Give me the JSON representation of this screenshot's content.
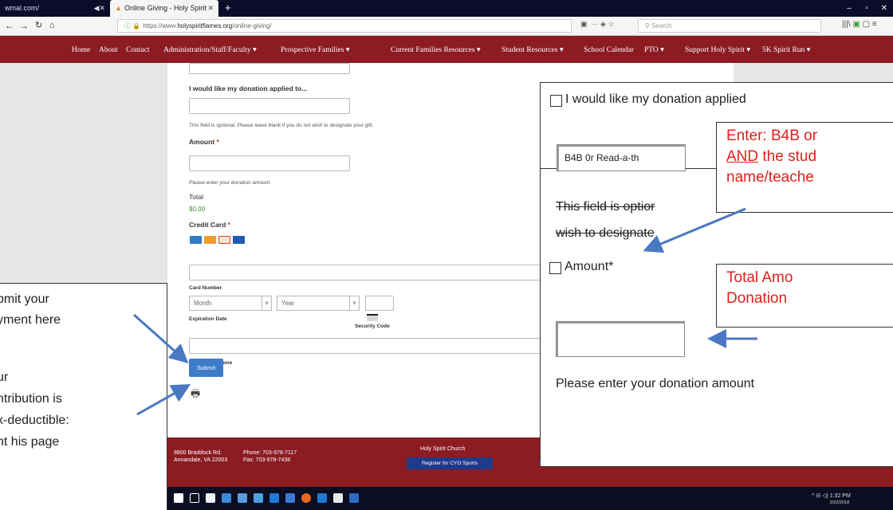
{
  "browser": {
    "tab1_title": "wmal.com/",
    "tab2_title": "Online Giving - Holy Spirit Sch",
    "new_tab": "+",
    "url_prefix": "https://www.",
    "url_domain": "holyspiritflames.org",
    "url_path": "/online-giving/",
    "search_placeholder": "Search"
  },
  "nav": {
    "items": [
      "Home",
      "About",
      "Contact",
      "Administration/Staff/Faculty ▾",
      "Prospective Families ▾",
      "Current Families Resources ▾",
      "Student Resources ▾",
      "School Calendar",
      "PTO ▾",
      "Support Holy Spirit ▾",
      "5K Spirit Run ▾"
    ]
  },
  "form": {
    "apply_label": "I would like my donation applied to...",
    "apply_help": "This field is optional. Please leave blank if you do not wish to designate your gift.",
    "amount_label": "Amount",
    "required_mark": "*",
    "amount_help": "Please enter your donation amount.",
    "total_label": "Total",
    "total_value": "$0.00",
    "credit_card_label": "Credit Card",
    "card_number_label": "Card Number",
    "month_placeholder": "Month",
    "year_placeholder": "Year",
    "expiration_label": "Expiration Date",
    "security_label": "Security Code",
    "cardholder_label": "Cardholder Name",
    "submit_label": "Submit"
  },
  "footer": {
    "address1": "8800 Braddock Rd.",
    "address2": "Annandale, VA 22003",
    "phone": "Phone: 703-978-7117",
    "fax": "Fax: 703-978-7438",
    "church": "Holy Spirit Church",
    "cyo_button": "Register for CYO Sports"
  },
  "taskbar": {
    "time": "1:32 PM",
    "date": "2/22/2018"
  },
  "zoom": {
    "apply_label": "I would like my donation applied",
    "input_value": "B4B 0r Read-a-th",
    "help_line1": "This field is optior",
    "help_line2": "wish to designate",
    "amount_label": "Amount*",
    "amount_help": "Please enter your donation amount"
  },
  "callouts": {
    "c1_line1": "Enter: B4B or",
    "c1_line2_u": "AND",
    "c1_line2_rest": " the stud",
    "c1_line3": "name/teache",
    "c2_line1": "Total Amo",
    "c2_line2": "Donation",
    "left_line1": "bmit your",
    "left_line2": "yment here",
    "left_line3": "ur",
    "left_line4": "ntribution is",
    "left_line5": "x-deductible:",
    "left_line6": "nt his page"
  }
}
